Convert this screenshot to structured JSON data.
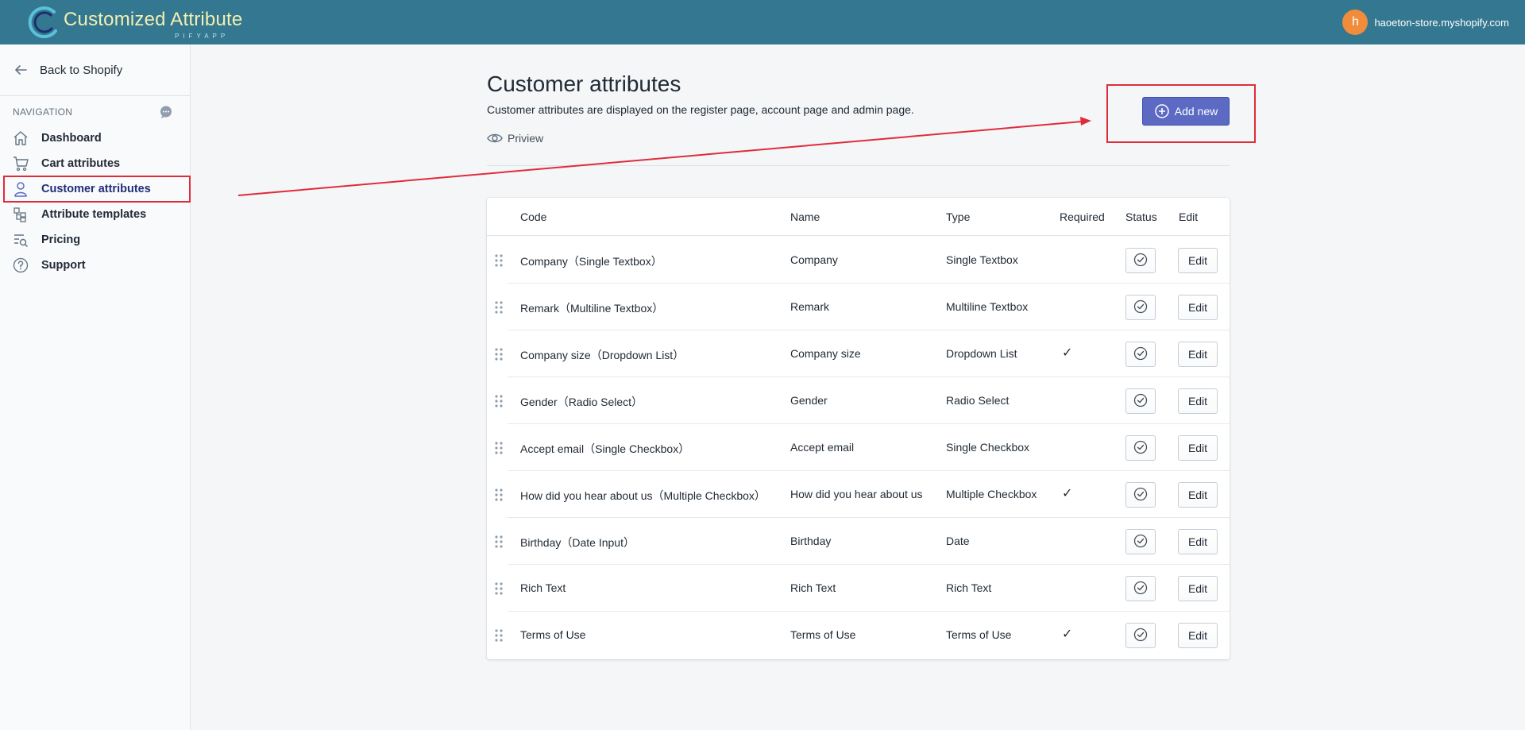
{
  "app": {
    "title": "Customized Attribute",
    "subtitle": "PIFYAPP",
    "account_initial": "h",
    "store": "haoeton-store.myshopify.com",
    "brand_color": "#347790",
    "accent_color": "#5c6ac4",
    "highlight_color": "#e02c3a"
  },
  "sidebar": {
    "back_label": "Back to Shopify",
    "nav_heading": "NAVIGATION",
    "items": [
      {
        "label": "Dashboard",
        "icon": "home-icon"
      },
      {
        "label": "Cart attributes",
        "icon": "cart-icon"
      },
      {
        "label": "Customer attributes",
        "icon": "customer-icon",
        "active": true
      },
      {
        "label": "Attribute templates",
        "icon": "templates-icon"
      },
      {
        "label": "Pricing",
        "icon": "pricing-icon"
      },
      {
        "label": "Support",
        "icon": "question-icon"
      }
    ]
  },
  "page": {
    "title": "Customer attributes",
    "description": "Customer attributes are displayed on the register page, account page and admin page.",
    "preview_label": "Priview",
    "add_button": "Add new"
  },
  "table": {
    "headers": {
      "code": "Code",
      "name": "Name",
      "type": "Type",
      "required": "Required",
      "status": "Status",
      "edit": "Edit"
    },
    "rows": [
      {
        "code": "Company（Single Textbox）",
        "name": "Company",
        "type": "Single Textbox",
        "required": "",
        "edit": "Edit"
      },
      {
        "code": "Remark（Multiline Textbox）",
        "name": "Remark",
        "type": "Multiline Textbox",
        "required": "",
        "edit": "Edit"
      },
      {
        "code": "Company size（Dropdown List）",
        "name": "Company size",
        "type": "Dropdown List",
        "required": "✓",
        "edit": "Edit"
      },
      {
        "code": "Gender（Radio Select）",
        "name": "Gender",
        "type": "Radio Select",
        "required": "",
        "edit": "Edit"
      },
      {
        "code": "Accept email（Single Checkbox）",
        "name": "Accept email",
        "type": "Single Checkbox",
        "required": "",
        "edit": "Edit"
      },
      {
        "code": "How did you hear about us（Multiple Checkbox）",
        "name": "How did you hear about us",
        "type": "Multiple Checkbox",
        "required": "✓",
        "edit": "Edit"
      },
      {
        "code": "Birthday（Date Input）",
        "name": "Birthday",
        "type": "Date",
        "required": "",
        "edit": "Edit"
      },
      {
        "code": "Rich Text",
        "name": "Rich Text",
        "type": "Rich Text",
        "required": "",
        "edit": "Edit"
      },
      {
        "code": "Terms of Use",
        "name": "Terms of Use",
        "type": "Terms of Use",
        "required": "✓",
        "edit": "Edit"
      }
    ]
  }
}
